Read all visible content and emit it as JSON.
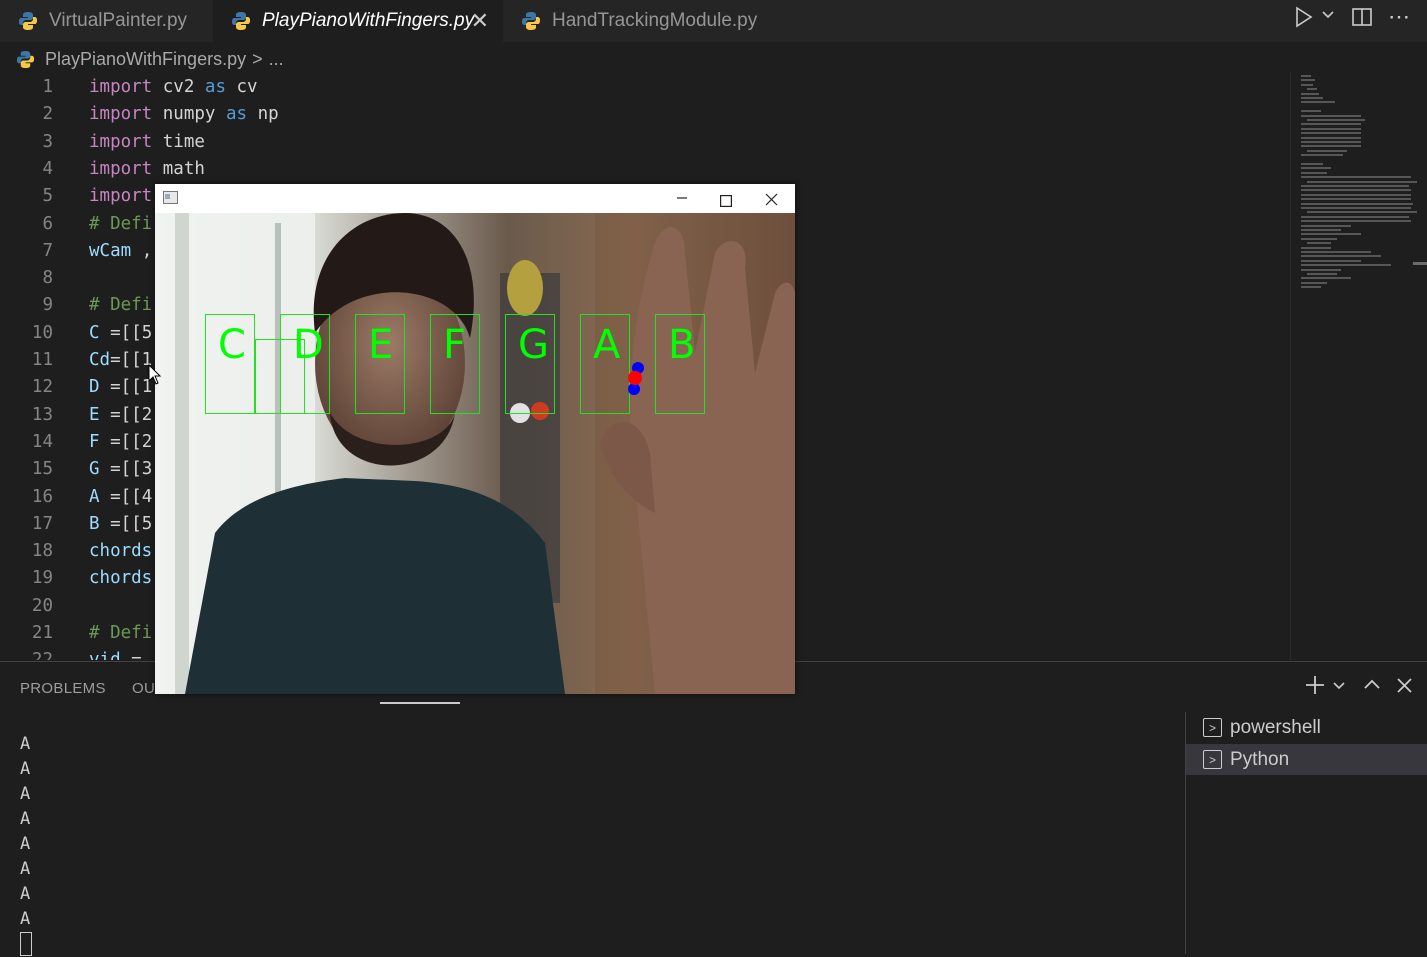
{
  "tabs": [
    {
      "label": "VirtualPainter.py",
      "active": false
    },
    {
      "label": "PlayPianoWithFingers.py",
      "active": true
    },
    {
      "label": "HandTrackingModule.py",
      "active": false
    }
  ],
  "toolbar": {
    "run_icon": "play-icon",
    "split_icon": "split-editor-icon",
    "more_icon": "more-icon"
  },
  "breadcrumb": {
    "file": "PlayPianoWithFingers.py",
    "sep": ">",
    "rest": "..."
  },
  "editor": {
    "lines": [
      {
        "n": "1",
        "a": "import",
        "b": " cv2 ",
        "c": "as",
        "d": " cv"
      },
      {
        "n": "2",
        "a": "import",
        "b": " numpy ",
        "c": "as",
        "d": " np"
      },
      {
        "n": "3",
        "a": "import",
        "b": " time",
        "c": "",
        "d": ""
      },
      {
        "n": "4",
        "a": "import",
        "b": " math",
        "c": "",
        "d": ""
      },
      {
        "n": "5",
        "a": "import",
        "b": "",
        "c": "",
        "d": ""
      },
      {
        "n": "6",
        "cm": "# Defi"
      },
      {
        "n": "7",
        "v": "wCam",
        "rest": " ,"
      },
      {
        "n": "8"
      },
      {
        "n": "9",
        "cm": "# Defi"
      },
      {
        "n": "10",
        "v": "C",
        "rest": " =[[5"
      },
      {
        "n": "11",
        "v": "Cd",
        "rest": "=[[1"
      },
      {
        "n": "12",
        "v": "D",
        "rest": " =[[1"
      },
      {
        "n": "13",
        "v": "E",
        "rest": " =[[2"
      },
      {
        "n": "14",
        "v": "F",
        "rest": " =[[2"
      },
      {
        "n": "15",
        "v": "G",
        "rest": " =[[3"
      },
      {
        "n": "16",
        "v": "A",
        "rest": " =[[4"
      },
      {
        "n": "17",
        "v": "B",
        "rest": " =[[5"
      },
      {
        "n": "18",
        "v": "chords",
        "rest": ""
      },
      {
        "n": "19",
        "v": "chords",
        "rest": ""
      },
      {
        "n": "20"
      },
      {
        "n": "21",
        "cm": "# Defi"
      },
      {
        "n": "22",
        "v": "vid",
        "rest": " ="
      }
    ]
  },
  "panel": {
    "tabs": [
      "PROBLEMS",
      "OU"
    ],
    "output_lines": [
      "A",
      "A",
      "A",
      "A",
      "A",
      "A",
      "A",
      "A"
    ],
    "terminals": [
      {
        "label": "powershell",
        "selected": false
      },
      {
        "label": "Python",
        "selected": true
      }
    ]
  },
  "camera": {
    "keys": [
      "C",
      "D",
      "E",
      "F",
      "G",
      "A",
      "B"
    ]
  },
  "colors": {
    "accent_green": "#00ff00",
    "fingertip_red": "#ff0000",
    "fingertip_blue": "#0000ff"
  }
}
